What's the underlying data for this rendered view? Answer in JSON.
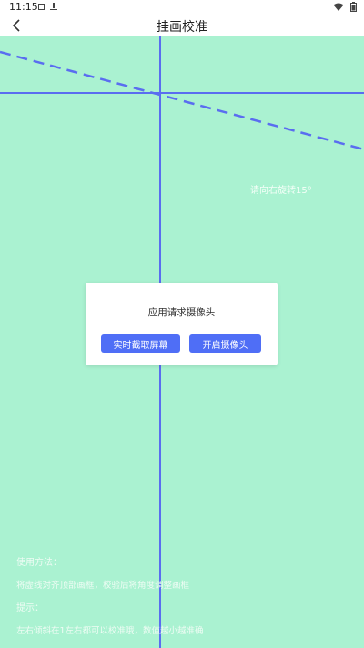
{
  "status_bar": {
    "time": "11:15",
    "icons": [
      "notification-square-icon",
      "download-icon",
      "wifi-icon",
      "battery-icon"
    ]
  },
  "app_bar": {
    "title": "挂画校准",
    "back_icon": "back-arrow-icon"
  },
  "canvas": {
    "background_color": "#aaf2d1",
    "line_color": "#5a6df0",
    "hint": "请向右旋转15°"
  },
  "usage": {
    "heading": "使用方法：",
    "instruction": "将虚线对齐顶部画框，校验后将角度调整画框",
    "tip_heading": "提示：",
    "tip_text": "左右倾斜在1左右都可以校准哦，数值越小越准确"
  },
  "dialog": {
    "title": "应用请求摄像头",
    "buttons": [
      {
        "label": "实时截取屏幕"
      },
      {
        "label": "开启摄像头"
      }
    ],
    "accent_color": "#4f6ef6"
  }
}
